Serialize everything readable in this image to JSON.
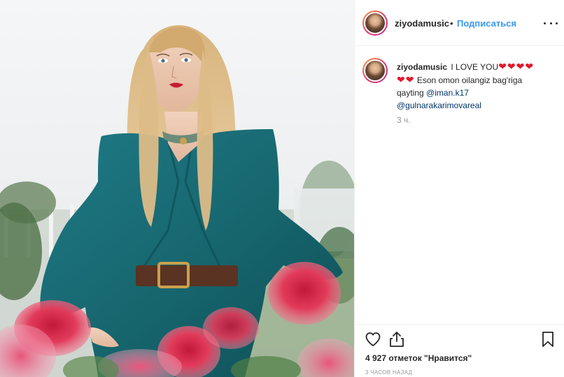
{
  "post": {
    "image_alt": "woman with long blonde hair in teal coat with red roses in foreground"
  },
  "header": {
    "username": "ziyodamusic",
    "separator": "•",
    "follow_label": "Подписаться",
    "more_icon": "more-options-icon"
  },
  "caption": {
    "username": "ziyodamusic",
    "text_start": "I LOVE YOU",
    "hearts_line1": "❤❤❤❤",
    "hearts_line2": "❤❤",
    "text_middle": "Eson omon oilangiz bag'riga qayting",
    "mention1": "@iman.k17",
    "mention2": "@gulnarakarimovareal",
    "time": "3 ч."
  },
  "actions": {
    "like_icon": "heart-outline-icon",
    "share_icon": "share-icon",
    "save_icon": "bookmark-icon",
    "likes_text": "4 927 отметок \"Нравится\"",
    "time_text": "3 ЧАСОВ НАЗАД"
  },
  "colors": {
    "accent": "#3897f0",
    "mention": "#003569",
    "text": "#262626",
    "muted": "#999999",
    "heart": "#e0192b"
  }
}
